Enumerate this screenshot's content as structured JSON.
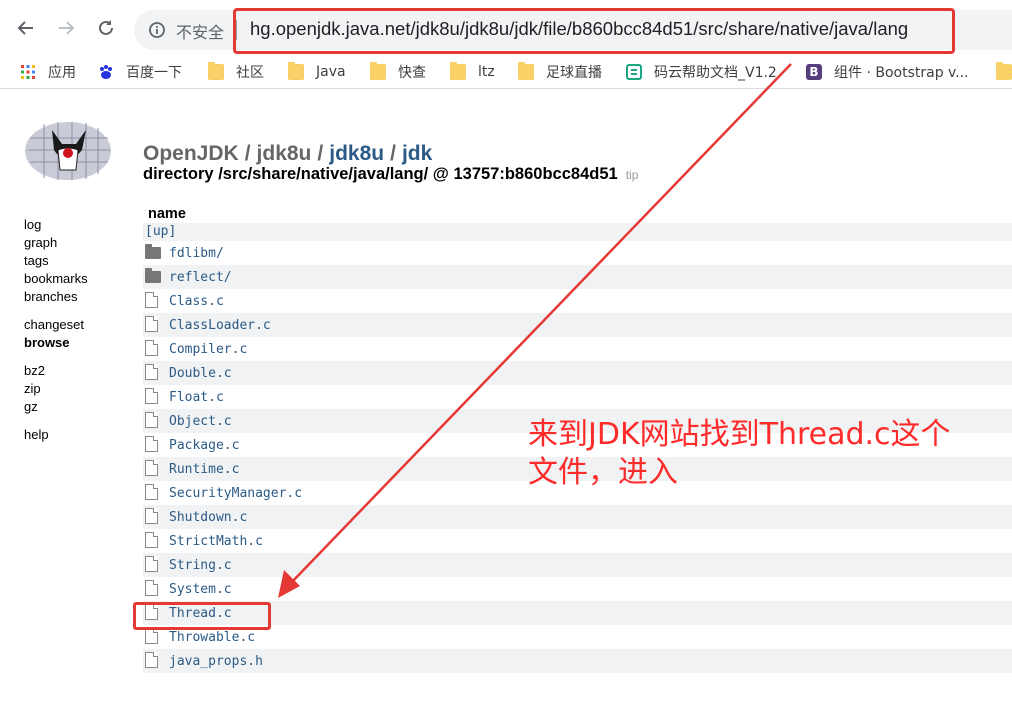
{
  "browser": {
    "insecure_label": "不安全",
    "url": "hg.openjdk.java.net/jdk8u/jdk8u/jdk/file/b860bcc84d51/src/share/native/java/lang",
    "bookmarks": [
      {
        "label": "应用",
        "icon": "apps-grid-icon"
      },
      {
        "label": "百度一下",
        "icon": "baidu-paw-icon"
      },
      {
        "label": "社区",
        "icon": "folder-icon"
      },
      {
        "label": "Java",
        "icon": "folder-icon"
      },
      {
        "label": "快查",
        "icon": "folder-icon"
      },
      {
        "label": "ltz",
        "icon": "folder-icon"
      },
      {
        "label": "足球直播",
        "icon": "folder-icon"
      },
      {
        "label": "码云帮助文档_V1.2",
        "icon": "gitee-doc-icon"
      },
      {
        "label": "组件 · Bootstrap v...",
        "icon": "bootstrap-icon"
      }
    ]
  },
  "header": {
    "crumbs": [
      "OpenJDK",
      "jdk8u",
      "jdk8u",
      "jdk"
    ],
    "separator": "/",
    "directory_line": "directory /src/share/native/java/lang/ @ 13757:b860bcc84d51",
    "tip": "tip"
  },
  "sidebar": {
    "group1": [
      "log",
      "graph",
      "tags",
      "bookmarks",
      "branches"
    ],
    "group2": [
      "changeset",
      "browse"
    ],
    "group3": [
      "bz2",
      "zip",
      "gz"
    ],
    "group4": [
      "help"
    ]
  },
  "listing": {
    "column_header": "name",
    "up_label": "[up]",
    "entries": [
      {
        "name": "fdlibm/",
        "type": "dir"
      },
      {
        "name": "reflect/",
        "type": "dir"
      },
      {
        "name": "Class.c",
        "type": "file"
      },
      {
        "name": "ClassLoader.c",
        "type": "file"
      },
      {
        "name": "Compiler.c",
        "type": "file"
      },
      {
        "name": "Double.c",
        "type": "file"
      },
      {
        "name": "Float.c",
        "type": "file"
      },
      {
        "name": "Object.c",
        "type": "file"
      },
      {
        "name": "Package.c",
        "type": "file"
      },
      {
        "name": "Runtime.c",
        "type": "file"
      },
      {
        "name": "SecurityManager.c",
        "type": "file"
      },
      {
        "name": "Shutdown.c",
        "type": "file"
      },
      {
        "name": "StrictMath.c",
        "type": "file"
      },
      {
        "name": "String.c",
        "type": "file"
      },
      {
        "name": "System.c",
        "type": "file"
      },
      {
        "name": "Thread.c",
        "type": "file"
      },
      {
        "name": "Throwable.c",
        "type": "file"
      },
      {
        "name": "java_props.h",
        "type": "file"
      }
    ]
  },
  "annotation": {
    "line1": "来到JDK网站找到Thread.c这个",
    "line2": "文件，进入",
    "color": "#e53935"
  }
}
